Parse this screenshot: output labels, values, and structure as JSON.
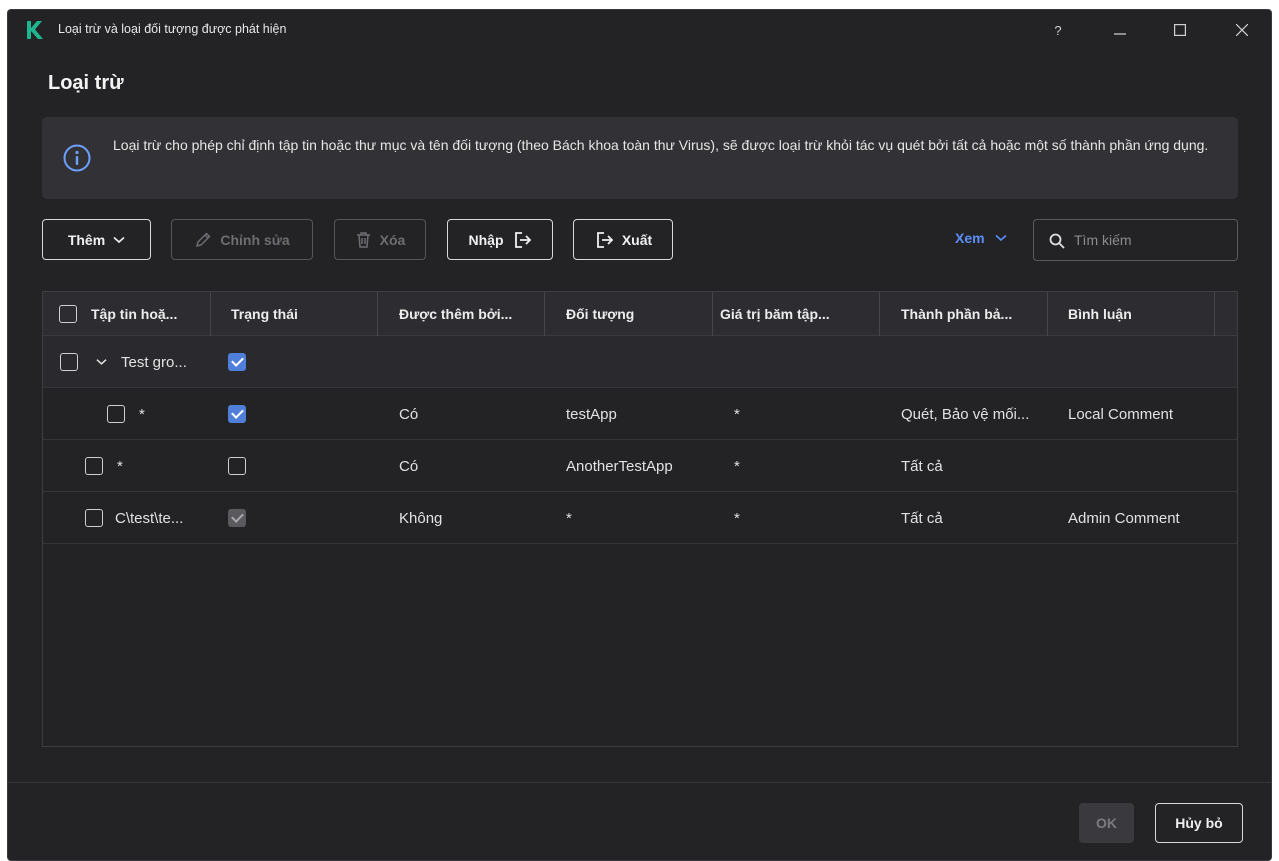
{
  "window": {
    "title": "Loại trừ và loại đối tượng được phát hiện",
    "help_label": "?"
  },
  "page": {
    "title": "Loại trừ"
  },
  "info": {
    "text": "Loại trừ cho phép chỉ định tập tin hoặc thư mục và tên đối tượng (theo Bách khoa toàn thư Virus), sẽ được loại trừ khỏi tác vụ quét bởi tất cả hoặc một số thành phần ứng dụng."
  },
  "toolbar": {
    "add_label": "Thêm",
    "edit_label": "Chỉnh sửa",
    "delete_label": "Xóa",
    "import_label": "Nhập",
    "export_label": "Xuất",
    "view_label": "Xem",
    "search_placeholder": "Tìm kiếm"
  },
  "table": {
    "columns": [
      "Tập tin hoặ...",
      "Trạng thái",
      "Được thêm bởi...",
      "Đối tượng",
      "Giá trị băm tập...",
      "Thành phần bả...",
      "Bình luận"
    ],
    "rows": [
      {
        "type": "group",
        "name": "Test gro...",
        "status_checked": true,
        "added_by": "",
        "object": "",
        "hash": "",
        "components": "",
        "comment": ""
      },
      {
        "type": "child",
        "name": "*",
        "status_checked": true,
        "added_by": "Có",
        "object": "testApp",
        "hash": "*",
        "components": "Quét, Bảo vệ mối...",
        "comment": "Local Comment"
      },
      {
        "type": "item",
        "name": "*",
        "status_checked": false,
        "added_by": "Có",
        "object": "AnotherTestApp",
        "hash": "*",
        "components": "Tất cả",
        "comment": ""
      },
      {
        "type": "item",
        "name": "C\\test\\te...",
        "status_checked": true,
        "status_disabled": true,
        "added_by": "Không",
        "object": "*",
        "hash": "*",
        "components": "Tất cả",
        "comment": "Admin Comment"
      }
    ]
  },
  "footer": {
    "ok_label": "OK",
    "cancel_label": "Hủy bỏ"
  },
  "colors": {
    "accent": "#5b8ff7",
    "checkbox_checked": "#4f7fd8",
    "window_bg": "#232326",
    "logo": "#1fb58f"
  }
}
